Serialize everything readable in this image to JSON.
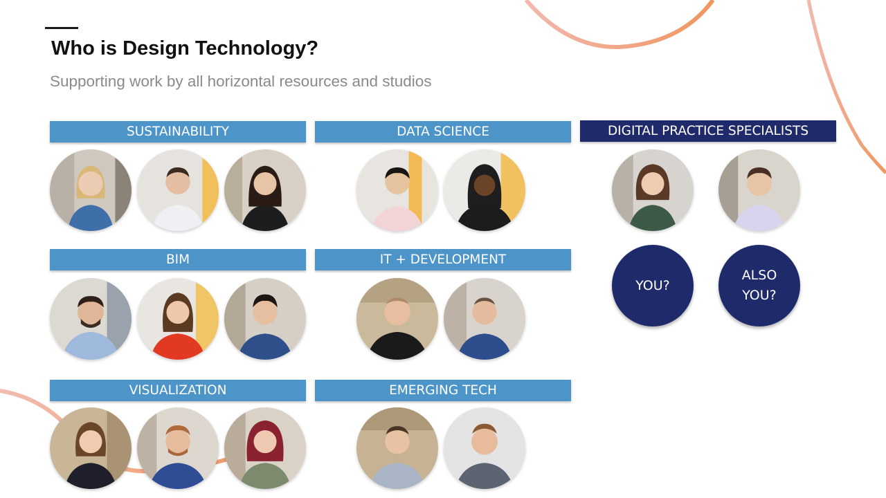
{
  "slide": {
    "title": "Who is Design Technology?",
    "subtitle": "Supporting work by all horizontal resources and studios"
  },
  "colors": {
    "label_bar": "#4d94c8",
    "label_bar_dark": "#1f2a6b",
    "accent_arc": "#e8907a",
    "bubble": "#1f2a6b"
  },
  "groups": {
    "sustainability": {
      "label": "SUSTAINABILITY"
    },
    "data_science": {
      "label": "DATA SCIENCE"
    },
    "digital_practice": {
      "label": "DIGITAL PRACTICE SPECIALISTS"
    },
    "bim": {
      "label": "BIM"
    },
    "it_development": {
      "label": "IT + DEVELOPMENT"
    },
    "visualization": {
      "label": "VISUALIZATION"
    },
    "emerging_tech": {
      "label": "EMERGING TECH"
    }
  },
  "bubbles": {
    "you": [
      "YOU?"
    ],
    "also_you": [
      "ALSO",
      "YOU?"
    ]
  }
}
